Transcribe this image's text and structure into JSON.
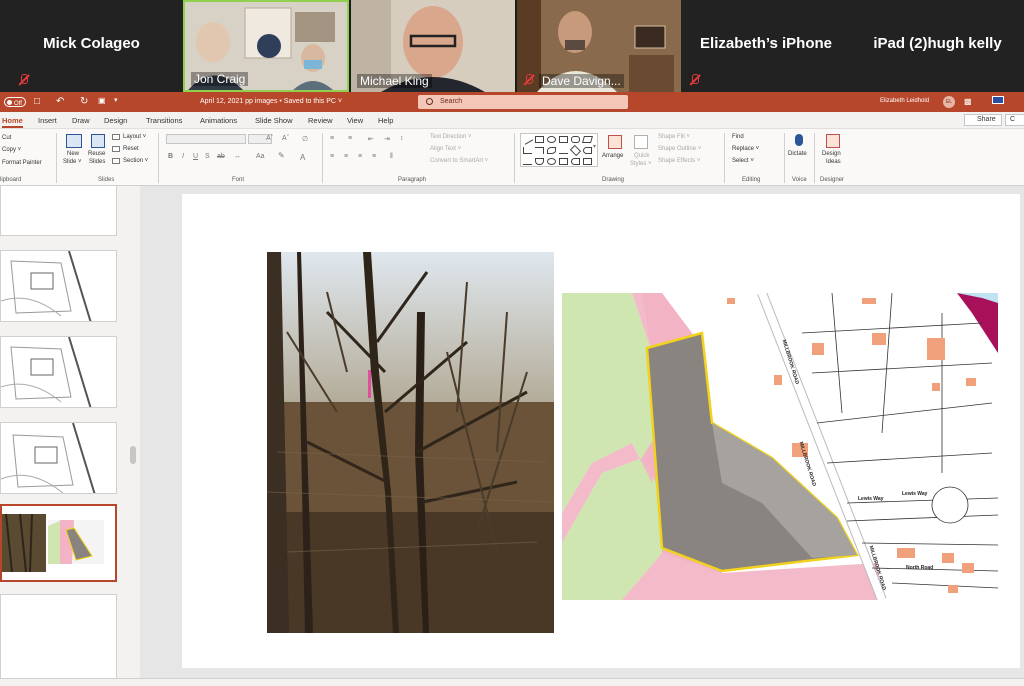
{
  "zoom": {
    "participants": [
      {
        "name": "Mick Colageo",
        "muted": true,
        "video": false
      },
      {
        "name": "Jon Craig",
        "muted": false,
        "video": true,
        "speaking": true
      },
      {
        "name": "Michael King",
        "muted": false,
        "video": true
      },
      {
        "name": "Dave Davign...",
        "muted": true,
        "video": true
      },
      {
        "name": "Elizabeth’s iPhone",
        "muted": false,
        "video": false
      },
      {
        "name": "iPad (2)hugh kelly",
        "muted": false,
        "video": false
      }
    ]
  },
  "ppt": {
    "titlebar": {
      "autosave_label": "Off",
      "doc_title": "April 12, 2021 pp images  •  Saved to this PC ˅",
      "search_placeholder": "Search",
      "user_name": "Elizabeth Leidhold",
      "user_initials": "EL"
    },
    "tabs": [
      "Home",
      "Insert",
      "Draw",
      "Design",
      "Transitions",
      "Animations",
      "Slide Show",
      "Review",
      "View",
      "Help"
    ],
    "share_label": "Share",
    "comments_label": "C",
    "ribbon": {
      "clipboard": {
        "cut": "Cut",
        "copy": "Copy ˅",
        "format_painter": "Format Painter",
        "label": "lipboard"
      },
      "slides": {
        "new_slide": "New",
        "new_slide2": "Slide ˅",
        "reuse": "Reuse",
        "reuse2": "Slides",
        "layout": "Layout ˅",
        "reset": "Reset",
        "section": "Section ˅",
        "label": "Slides"
      },
      "font": {
        "label": "Font"
      },
      "paragraph": {
        "text_direction": "Text Direction ˅",
        "align_text": "Align Text ˅",
        "convert_smartart": "Convert to SmartArt ˅",
        "label": "Paragraph"
      },
      "drawing": {
        "arrange": "Arrange",
        "quick_styles": "Quick",
        "quick_styles2": "Styles ˅",
        "shape_fill": "Shape Fill ˅",
        "shape_outline": "Shape Outline ˅",
        "shape_effects": "Shape Effects ˅",
        "label": "Drawing"
      },
      "editing": {
        "find": "Find",
        "replace": "Replace ˅",
        "select": "Select ˅",
        "label": "Editing"
      },
      "voice": {
        "dictate": "Dictate",
        "label": "Voice"
      },
      "designer": {
        "design_ideas": "Design",
        "design_ideas2": "Ideas",
        "label": "Designer"
      }
    }
  },
  "map": {
    "road_labels": [
      "MILLBROOK ROAD",
      "MILLBROOK ROAD",
      "Lewis Way",
      "Lewis Way",
      "North Road",
      "MILLBROOK ROAD"
    ],
    "colors": {
      "green": "#cfe6b0",
      "pink": "#f2b3c4",
      "parcel": "#8a8480",
      "outline": "#f2d21c"
    }
  }
}
